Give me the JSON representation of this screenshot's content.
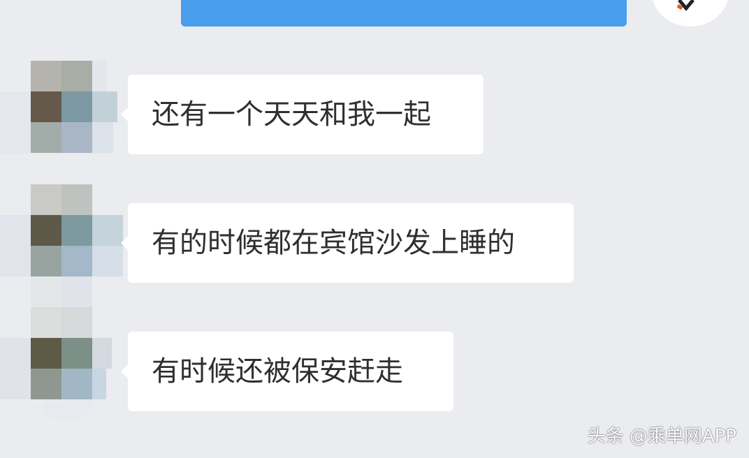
{
  "chat": {
    "top_message": {
      "text": "",
      "bubble_color": "#4A9DEB"
    },
    "messages": [
      {
        "sender": "other",
        "text": "还有一个天天和我一起"
      },
      {
        "sender": "other",
        "text": "有的时候都在宾馆沙发上睡的"
      },
      {
        "sender": "other",
        "text": "有时候还被保安赶走"
      }
    ]
  },
  "watermark": {
    "text": "头条 @乘单网APP"
  },
  "colors": {
    "background": "#EBECF0",
    "bubble": "#FFFFFF",
    "text": "#2F2F2F",
    "sent_bubble": "#4A9DEB",
    "avatar_icon_accent": "#E2572B"
  },
  "icons": {
    "self_avatar": "avatar-icon",
    "contact_avatar": "pixelated-avatar"
  }
}
